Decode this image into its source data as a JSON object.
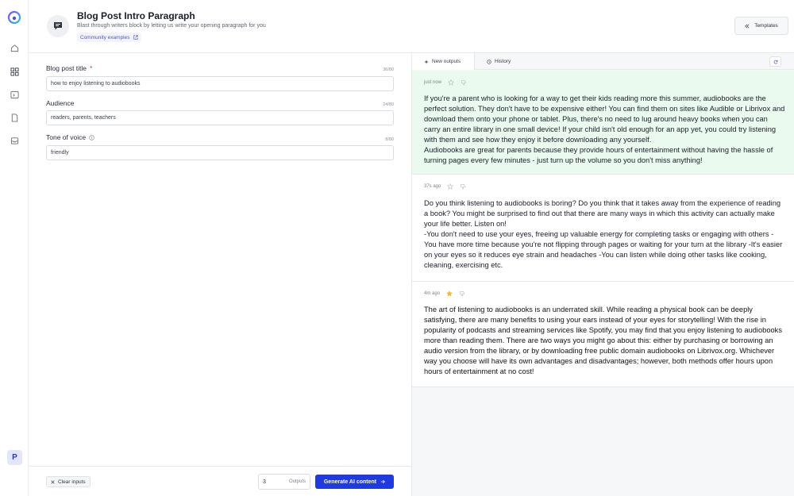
{
  "rail": {
    "avatar_letter": "P",
    "nav_icons": [
      "home-icon",
      "grid-icon",
      "terminal-icon",
      "document-icon",
      "inbox-icon"
    ]
  },
  "header": {
    "title": "Blog Post Intro Paragraph",
    "subtitle": "Blast through writers block by letting us write your opening paragraph for you",
    "community_link": "Community examples",
    "templates_button": "Templates"
  },
  "form": {
    "fields": [
      {
        "label": "Blog post title",
        "required": "*",
        "count": "36/80",
        "value": "how to enjoy listening to audiobooks"
      },
      {
        "label": "Audience",
        "count": "24/80",
        "value": "readers, parents, teachers"
      },
      {
        "label": "Tone of voice",
        "count": "8/80",
        "value": "friendly"
      }
    ],
    "clear_button": "Clear inputs",
    "outputs_count": "3",
    "outputs_label": "Outputs",
    "generate_button": "Generate AI content"
  },
  "output_tabs": {
    "new_outputs": "New outputs",
    "history": "History"
  },
  "results": [
    {
      "time": "just now",
      "starred": false,
      "text": "If you're a parent who is looking for a way to get their kids reading more this summer, audiobooks are the perfect solution. They don't have to be expensive either! You can find them on sites like Audible or Librivox and download them onto your phone or tablet. Plus, there's no need to lug around heavy books when you can carry an entire library in one small device! If your child isn't old enough for an app yet, you could try listening with them and see how they enjoy it before downloading any yourself.\nAudiobooks are great for parents because they provide hours of entertainment without having the hassle of turning pages every few minutes - just turn up the volume so you don't miss anything!"
    },
    {
      "time": "37s ago",
      "starred": false,
      "text": "Do you think listening to audiobooks is boring? Do you think that it takes away from the experience of reading a book? You might be surprised to find out that there are many ways in which this activity can actually make your life better. Listen on!\n-You don't need to use your eyes, freeing up valuable energy for completing tasks or engaging with others   -You have more time because you're not flipping through pages or waiting for your turn at the library  -It's easier on your eyes so it reduces eye strain and headaches  -You can listen while doing other tasks like cooking, cleaning, exercising etc."
    },
    {
      "time": "4m ago",
      "starred": true,
      "text": "The art of listening to audiobooks is an underrated skill. While reading a physical book can be deeply satisfying, there are many benefits to using your ears instead of your eyes for storytelling! With the rise in popularity of podcasts and streaming services like Spotify, you may find that you enjoy listening to audiobooks more than reading them.  There are two ways you might go about this: either by purchasing or borrowing an audio version from the library, or by downloading free public domain audiobooks on Librivox.org. Whichever way you choose will have its own advantages and disadvantages; however, both methods offer hours upon hours of entertainment at no cost!"
    }
  ],
  "colors": {
    "accent": "#1f3ae0",
    "selected_card": "#eafaee",
    "star_active": "#f2c21b"
  }
}
